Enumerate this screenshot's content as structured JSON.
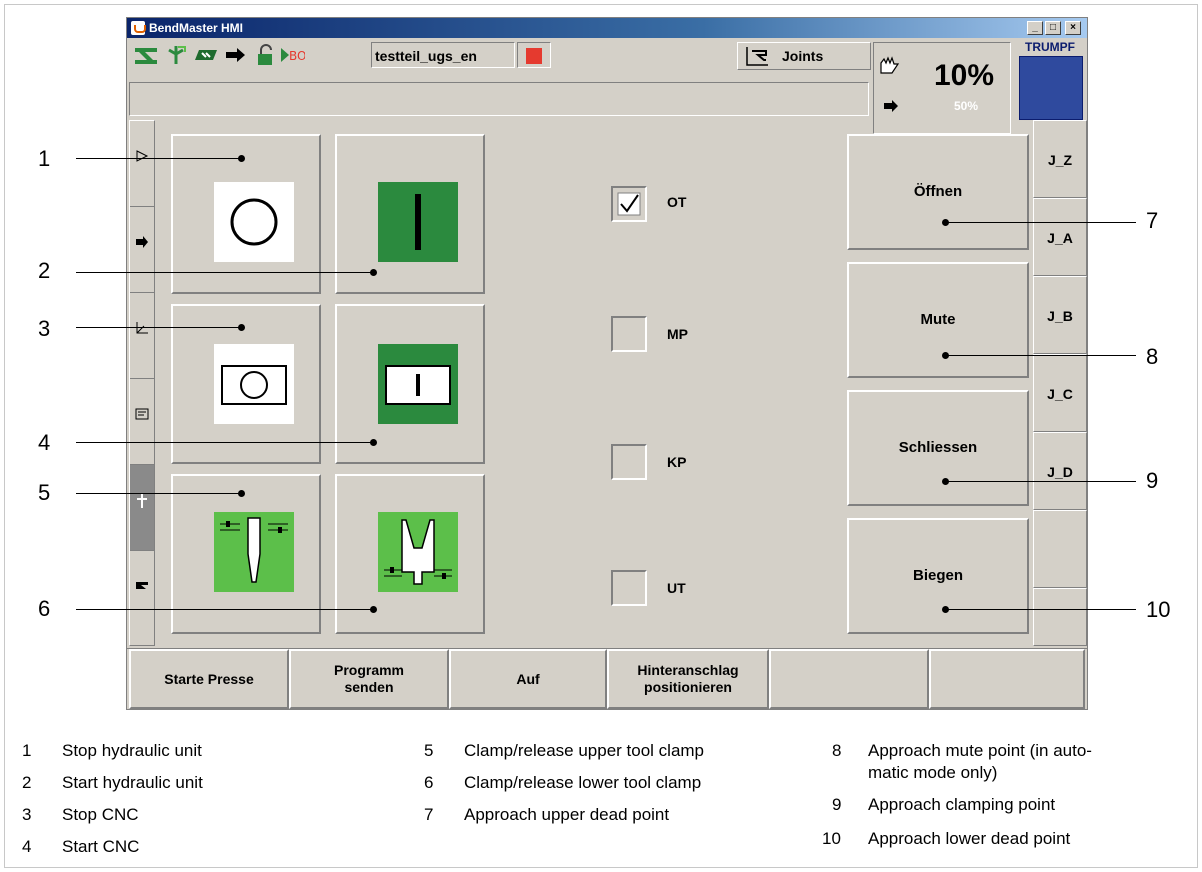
{
  "window": {
    "title": "BendMaster HMI",
    "controls": [
      "_",
      "□",
      "×"
    ]
  },
  "toolbar": {
    "program_name": "testteil_ugs_en",
    "joints_label": "Joints",
    "speed_main": "10%",
    "speed_secondary": "50%",
    "brand": "TRUMPF"
  },
  "main": {
    "checkboxes": [
      {
        "label": "OT",
        "checked": true
      },
      {
        "label": "MP",
        "checked": false
      },
      {
        "label": "KP",
        "checked": false
      },
      {
        "label": "UT",
        "checked": false
      }
    ],
    "actions": [
      "Öffnen",
      "Mute",
      "Schliessen",
      "Biegen"
    ],
    "joint_buttons": [
      "J_Z",
      "J_A",
      "J_B",
      "J_C",
      "J_D",
      "",
      ""
    ]
  },
  "function_keys": [
    "Starte Presse",
    "Programm\nsenden",
    "Auf",
    "Hinteranschlag\npositionieren",
    "",
    ""
  ],
  "callouts": [
    "1",
    "2",
    "3",
    "4",
    "5",
    "6",
    "7",
    "8",
    "9",
    "10"
  ],
  "legend": [
    {
      "num": "1",
      "text": "Stop hydraulic unit"
    },
    {
      "num": "2",
      "text": "Start hydraulic unit"
    },
    {
      "num": "3",
      "text": "Stop CNC"
    },
    {
      "num": "4",
      "text": "Start CNC"
    },
    {
      "num": "5",
      "text": "Clamp/release upper tool clamp"
    },
    {
      "num": "6",
      "text": "Clamp/release lower tool clamp"
    },
    {
      "num": "7",
      "text": "Approach upper dead point"
    },
    {
      "num": "8",
      "text": "Approach mute point (in automatic mode only)",
      "line1": "Approach mute point (in auto-",
      "line2": "matic mode only)"
    },
    {
      "num": "9",
      "text": "Approach clamping point"
    },
    {
      "num": "10",
      "text": "Approach lower dead point"
    }
  ],
  "colors": {
    "window_bg": "#d4d0c8",
    "green_dark": "#2b8a3e",
    "green_light": "#5cbf4a",
    "stop_red": "#e53a2f",
    "title_blue": "#0a246a",
    "brand_blue": "#2f4a9e"
  }
}
